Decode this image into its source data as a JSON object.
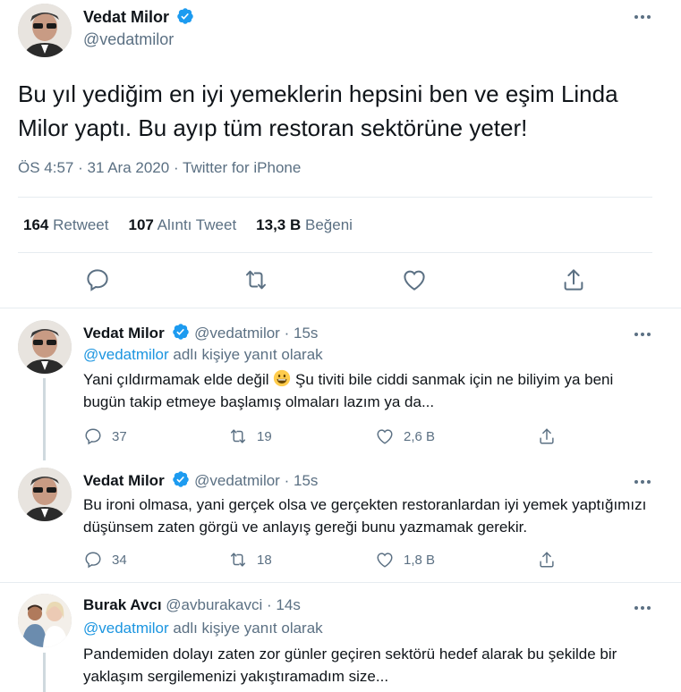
{
  "main_tweet": {
    "author_name": "Vedat Milor",
    "author_handle": "@vedatmilor",
    "text": "Bu yıl yediğim en iyi yemeklerin hepsini ben ve eşim Linda Milor yaptı. Bu ayıp tüm restoran sektörüne yeter!",
    "time": "ÖS 4:57",
    "date": "31 Ara 2020",
    "source": "Twitter for iPhone",
    "separator": "·",
    "stats": {
      "retweets_count": "164",
      "retweets_label": "Retweet",
      "quotes_count": "107",
      "quotes_label": "Alıntı Tweet",
      "likes_count": "13,3 B",
      "likes_label": "Beğeni"
    },
    "icons": [
      "reply-icon",
      "retweet-icon",
      "like-icon",
      "share-icon"
    ]
  },
  "replies": [
    {
      "author_name": "Vedat Milor",
      "author_handle": "@vedatmilor",
      "separator": "·",
      "time": "15s",
      "replying_to_mention": "@vedatmilor",
      "replying_to_suffix": "adlı kişiye yanıt olarak",
      "text_before_emoji": "Yani çıldırmamak elde değil ",
      "text_after_emoji": " Şu tiviti bile ciddi sanmak için ne biliyim ya beni bugün takip etmeye başlamış olmaları lazım ya da...",
      "reply_count": "37",
      "retweet_count": "19",
      "like_count": "2,6 B"
    },
    {
      "author_name": "Vedat Milor",
      "author_handle": "@vedatmilor",
      "separator": "·",
      "time": "15s",
      "text": "Bu ironi olmasa, yani gerçek olsa ve gerçekten restoranlardan iyi yemek yaptığımızı düşünsem zaten görgü ve anlayış gereği bunu yazmamak gerekir.",
      "reply_count": "34",
      "retweet_count": "18",
      "like_count": "1,8 B"
    },
    {
      "author_name": "Burak Avcı",
      "author_handle": "@avburakavci",
      "separator": "·",
      "time": "14s",
      "replying_to_mention": "@vedatmilor",
      "replying_to_suffix": "adlı kişiye yanıt olarak",
      "text": "Pandemiden dolayı zaten zor günler geçiren sektörü hedef alarak bu şekilde bir yaklaşım sergilemenizi yakıştıramadım size..."
    }
  ],
  "colors": {
    "text": "#0f1419",
    "secondary": "#5b7083",
    "link": "#1b95e0",
    "verified": "#1d9bf0",
    "divider": "#e6ecf0"
  }
}
